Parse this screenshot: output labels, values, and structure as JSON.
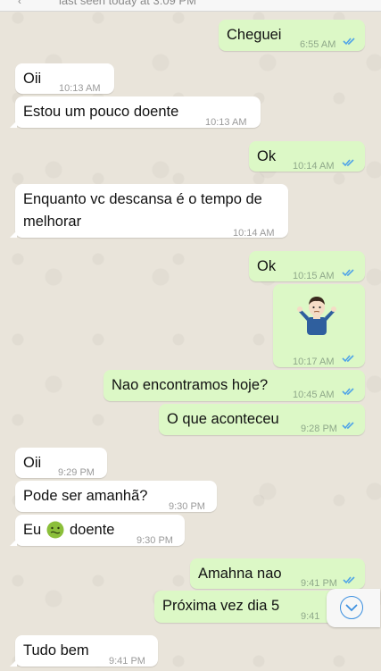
{
  "header": {
    "last_seen": "last seen today at 3:09 PM"
  },
  "messages": [
    {
      "dir": "out",
      "text": "Cheguei",
      "time": "6:55 AM"
    },
    {
      "dir": "in",
      "text": "Oii",
      "time": "10:13 AM"
    },
    {
      "dir": "in",
      "text": "Estou um pouco doente",
      "time": "10:13 AM"
    },
    {
      "dir": "out",
      "text": "Ok",
      "time": "10:14 AM"
    },
    {
      "dir": "in",
      "text": "Enquanto vc descansa é o tempo de melhorar",
      "time": "10:14 AM"
    },
    {
      "dir": "out",
      "text": "Ok",
      "time": "10:15 AM"
    },
    {
      "dir": "out",
      "text": "",
      "emoji": "man-shrugging",
      "time": "10:17 AM"
    },
    {
      "dir": "out",
      "text": "Nao encontramos hoje?",
      "time": "10:45 AM"
    },
    {
      "dir": "out",
      "text": "O que aconteceu",
      "time": "9:28 PM"
    },
    {
      "dir": "in",
      "text": "Oii",
      "time": "9:29 PM"
    },
    {
      "dir": "in",
      "text": "Pode ser amanhã?",
      "time": "9:30 PM"
    },
    {
      "dir": "in",
      "text_before": "Eu",
      "emoji": "nauseated-face",
      "text_after": "doente",
      "time": "9:30 PM"
    },
    {
      "dir": "out",
      "text": "Amahna nao",
      "time": "9:41 PM"
    },
    {
      "dir": "out",
      "text": "Próxima vez dia 5",
      "time": "9:41"
    },
    {
      "dir": "in",
      "text": "Tudo bem",
      "time": "9:41 PM"
    }
  ],
  "colors": {
    "outgoing_bubble": "#dcf8c6",
    "incoming_bubble": "#ffffff",
    "read_ticks": "#4fa3e8",
    "wallpaper": "#e9e4da"
  },
  "controls": {
    "scroll_down_icon": "chevron-down-circle-icon"
  }
}
